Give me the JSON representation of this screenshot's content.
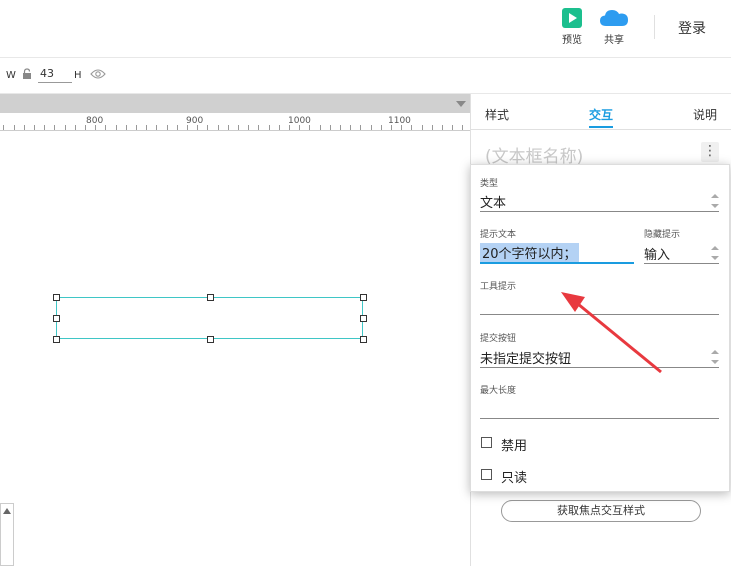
{
  "topbar": {
    "preview_label": "预览",
    "share_label": "共享",
    "login_label": "登录",
    "preview_color": "#1cbf8e",
    "share_color": "#2d9cf0"
  },
  "toolbar2": {
    "width_label": "W",
    "height_value": "43",
    "height_label": "H"
  },
  "ruler": {
    "labels": [
      "800",
      "900",
      "1000",
      "1100"
    ]
  },
  "panel": {
    "tabs": [
      "样式",
      "交互",
      "说明"
    ],
    "active_tab": "交互",
    "widget_name_placeholder": "(文本框名称)",
    "focus_button_label": "获取焦点交互样式"
  },
  "form": {
    "type_label": "类型",
    "type_value": "文本",
    "hint_label": "提示文本",
    "hint_value": "20个字符以内；",
    "hide_hint_label": "隐藏提示",
    "hide_hint_value": "输入",
    "tooltip_label": "工具提示",
    "tooltip_value": "",
    "submit_label": "提交按钮",
    "submit_value": "未指定提交按钮",
    "maxlen_label": "最大长度",
    "maxlen_value": "",
    "disabled_label": "禁用",
    "disabled_checked": false,
    "readonly_label": "只读",
    "readonly_checked": false
  },
  "colors": {
    "accent": "#1a9ce0",
    "selection": "#3fc6c6",
    "annotation_arrow": "#e8393f"
  }
}
